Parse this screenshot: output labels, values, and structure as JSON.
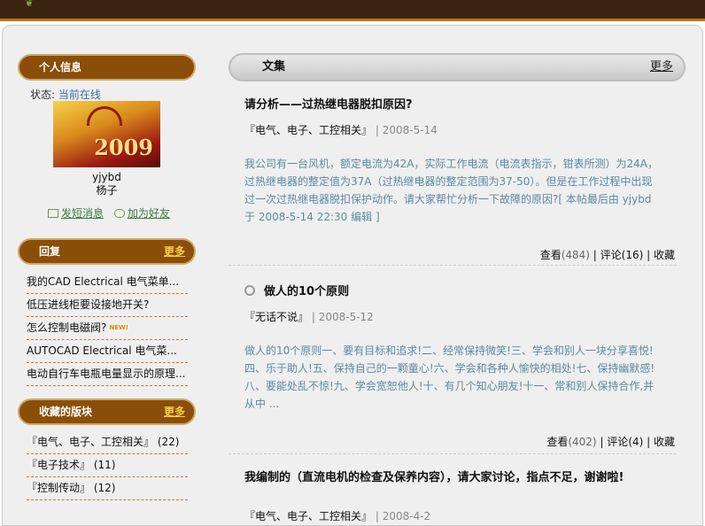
{
  "sidebar": {
    "profile": {
      "title": "个人信息",
      "status_label": "状态:",
      "status_value": "当前在线",
      "avatar_text": "2009",
      "username": "yjybd",
      "nickname": "杨子",
      "send_message": "发短消息",
      "add_friend": "加为好友"
    },
    "replies": {
      "title": "回复",
      "more": "更多",
      "items": [
        "我的CAD Electrical 电气菜单...",
        "低压进线柜要设接地开关?",
        "怎么控制电磁阀?",
        "AUTOCAD Electrical 电气菜...",
        "电动自行车电瓶电量显示的原理..."
      ],
      "new_badge": "NEW!"
    },
    "favorites": {
      "title": "收藏的版块",
      "more": "更多",
      "items": [
        "『电气、电子、工控相关』 (22)",
        "『电子技术』 (11)",
        "『控制传动』 (12)"
      ]
    }
  },
  "main": {
    "header_title": "文集",
    "header_more": "更多",
    "posts": [
      {
        "title": "请分析——过热继电器脱扣原因?",
        "category": "『电气、电子、工控相关』",
        "date": "| 2008-5-14",
        "excerpt": "我公司有一台风机，额定电流为42A，实际工作电流（电流表指示，钳表所测）为24A，过热继电器的整定值为37A（过热继电器的整定范围为37-50）。但是在工作过程中出现过一次过热继电器脱扣保护动作。请大家帮忙分析一下故障的原因?[ 本帖最后由 yjybd 于 2008-5-14 22:30 编辑 ]",
        "views_label": "查看",
        "views": "(484)",
        "comments_label": "评论",
        "comments": "(16)",
        "favorite": "收藏"
      },
      {
        "title": "做人的10个原则",
        "category": "『无话不说』",
        "date": "| 2008-5-12",
        "excerpt": "做人的10个原则一、要有目标和追求!二、经常保持微笑!三、学会和别人一块分享喜悦!四、乐于助人!五、保持自己的一颗童心!六、学会和各种人愉快的相处!七、保持幽默感!八、要能处乱不惊!九、学会宽恕他人!十、有几个知心朋友!十一、常和别人保持合作,并从中 ...",
        "views_label": "查看",
        "views": "(402)",
        "comments_label": "评论",
        "comments": "(4)",
        "favorite": "收藏"
      },
      {
        "title": "我编制的（直流电机的检查及保养内容），请大家讨论，指点不足，谢谢啦!",
        "category": "『电气、电子、工控相关』",
        "date": "| 2008-4-2"
      }
    ]
  }
}
